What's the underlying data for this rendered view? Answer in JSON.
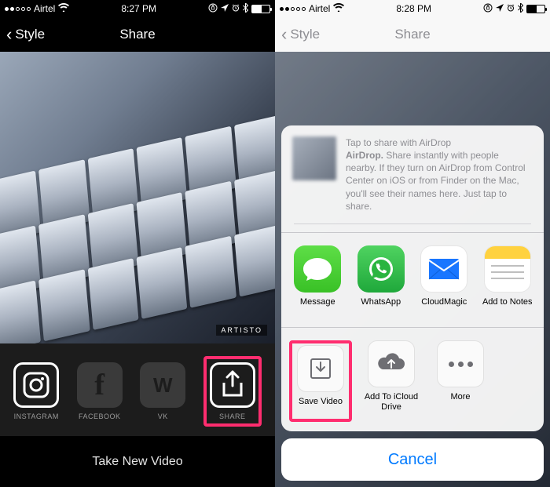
{
  "left": {
    "status": {
      "carrier": "Airtel",
      "time": "8:27 PM"
    },
    "nav_back": "Style",
    "nav_title": "Share",
    "watermark": "ARTISTO",
    "share": {
      "instagram": "INSTAGRAM",
      "facebook": "FACEBOOK",
      "vk": "VK",
      "share": "SHARE"
    },
    "take_new": "Take New Video"
  },
  "right": {
    "status": {
      "carrier": "Airtel",
      "time": "8:28 PM"
    },
    "nav_back": "Style",
    "nav_title": "Share",
    "airdrop": {
      "title": "Tap to share with AirDrop",
      "bold": "AirDrop.",
      "body": " Share instantly with people nearby. If they turn on AirDrop from Control Center on iOS or from Finder on the Mac, you'll see their names here. Just tap to share."
    },
    "apps": {
      "message": "Message",
      "whatsapp": "WhatsApp",
      "cloudmagic": "CloudMagic",
      "notes": "Add to Notes"
    },
    "actions": {
      "save_video": "Save Video",
      "icloud": "Add To iCloud Drive",
      "more": "More"
    },
    "cancel": "Cancel"
  }
}
